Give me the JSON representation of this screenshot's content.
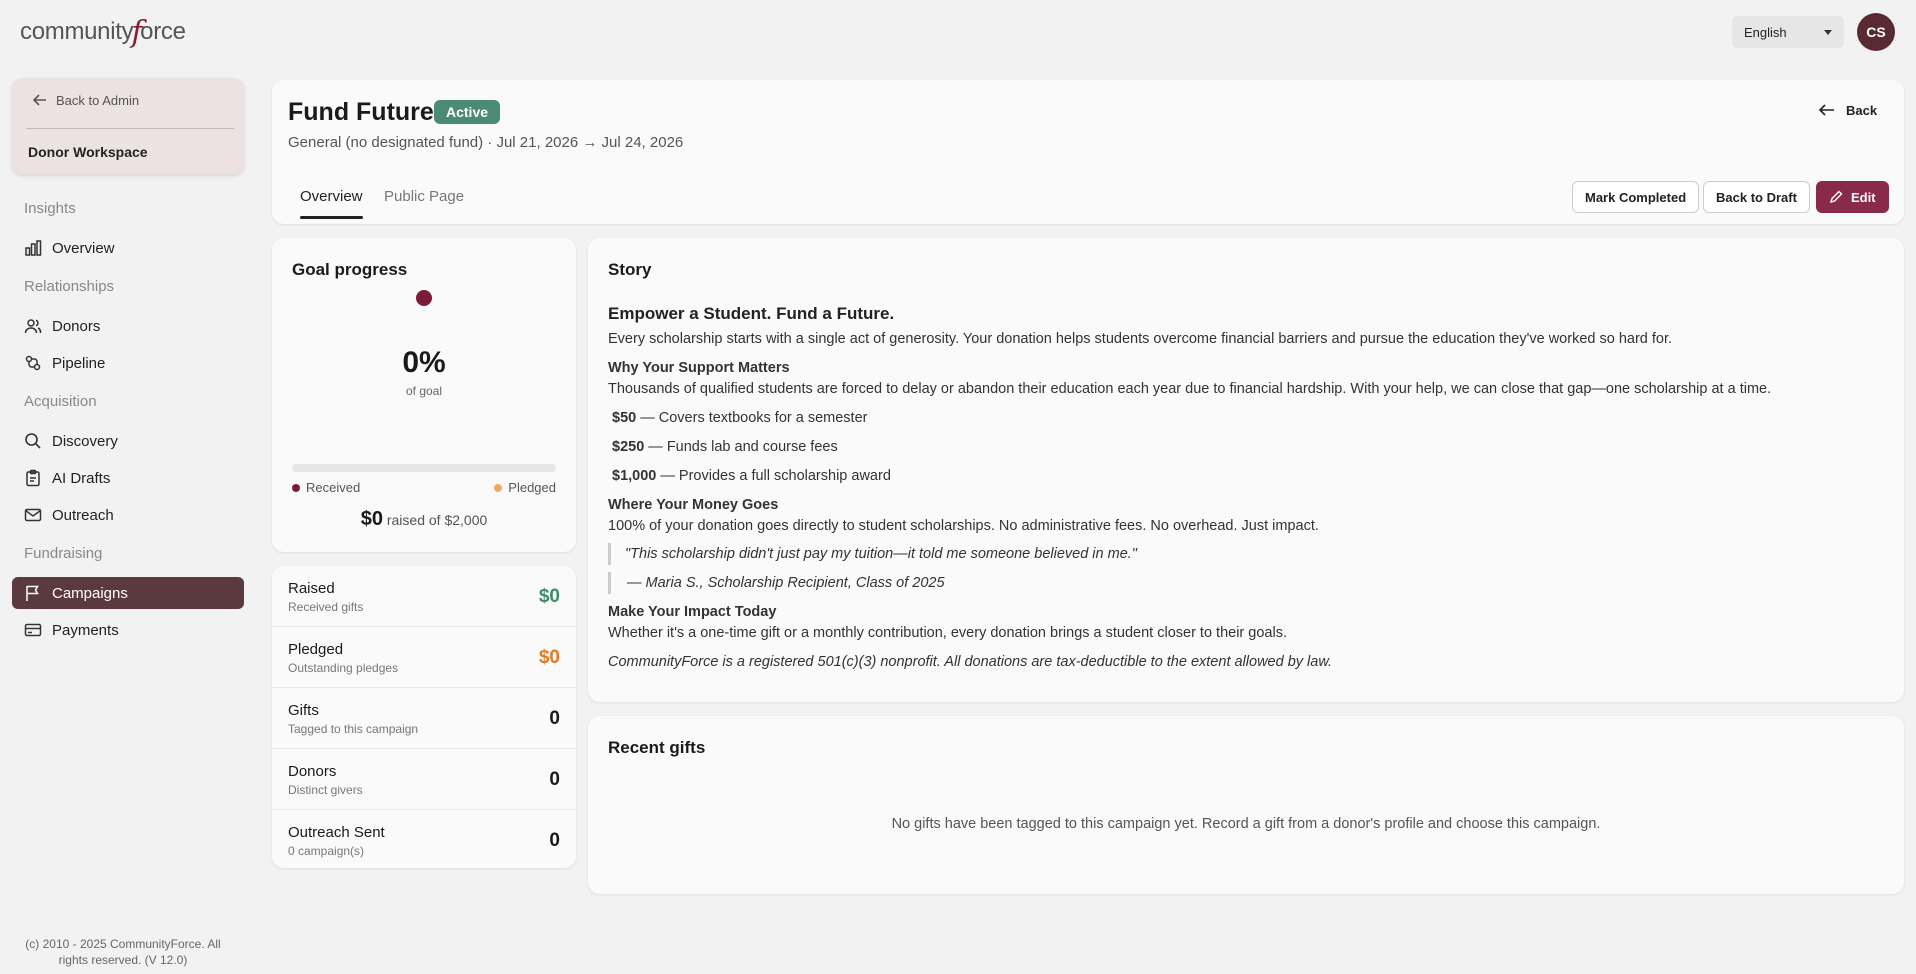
{
  "app": {
    "logo_text_pre": "community",
    "logo_text_f": "f",
    "logo_text_post": "orce",
    "language": "English",
    "avatar_initials": "CS"
  },
  "sidebar": {
    "back_label": "Back to Admin",
    "workspace": "Donor Workspace",
    "sections": {
      "insights": "Insights",
      "relationships": "Relationships",
      "acquisition": "Acquisition",
      "fundraising": "Fundraising"
    },
    "items": {
      "overview": "Overview",
      "donors": "Donors",
      "pipeline": "Pipeline",
      "discovery": "Discovery",
      "ai_drafts": "AI Drafts",
      "outreach": "Outreach",
      "campaigns": "Campaigns",
      "payments": "Payments"
    },
    "footer": "(c) 2010 - 2025 CommunityForce. All rights reserved. (V 12.0)"
  },
  "header": {
    "title": "Fund Future",
    "status": "Active",
    "subtitle": "General (no designated fund) · Jul 21, 2026 → Jul 24, 2026",
    "back": "Back",
    "tabs": {
      "overview": "Overview",
      "public_page": "Public Page"
    },
    "actions": {
      "mark_completed": "Mark Completed",
      "back_to_draft": "Back to Draft",
      "edit": "Edit"
    }
  },
  "goal": {
    "title": "Goal progress",
    "percent": "0%",
    "percent_sub": "of goal",
    "progress_fraction": 0,
    "legend_received": "Received",
    "legend_pledged": "Pledged",
    "raised_amount": "$0",
    "raised_text": "raised of $2,000",
    "colors": {
      "received": "#7a1e38",
      "pledged": "#f0a860"
    }
  },
  "stats": [
    {
      "label": "Raised",
      "sub": "Received gifts",
      "value": "$0",
      "color": "#3f8a6c"
    },
    {
      "label": "Pledged",
      "sub": "Outstanding pledges",
      "value": "$0",
      "color": "#e07a1f"
    },
    {
      "label": "Gifts",
      "sub": "Tagged to this campaign",
      "value": "0",
      "color": "#1a1a1a"
    },
    {
      "label": "Donors",
      "sub": "Distinct givers",
      "value": "0",
      "color": "#1a1a1a"
    },
    {
      "label": "Outreach Sent",
      "sub": "0 campaign(s)",
      "value": "0",
      "color": "#1a1a1a"
    }
  ],
  "story": {
    "title": "Story",
    "headline": "Empower a Student. Fund a Future.",
    "intro": "Every scholarship starts with a single act of generosity. Your donation helps students overcome financial barriers and pursue the education they've worked so hard for.",
    "why_heading": "Why Your Support Matters",
    "why_text": "Thousands of qualified students are forced to delay or abandon their education each year due to financial hardship. With your help, we can close that gap—one scholarship at a time.",
    "tiers": [
      {
        "amount": "$50",
        "text": " — Covers textbooks for a semester"
      },
      {
        "amount": "$250",
        "text": " — Funds lab and course fees"
      },
      {
        "amount": "$1,000",
        "text": " — Provides a full scholarship award"
      }
    ],
    "money_heading": "Where Your Money Goes",
    "money_text": "100% of your donation goes directly to student scholarships. No administrative fees. No overhead. Just impact.",
    "quote": "\"This scholarship didn't just pay my tuition—it told me someone believed in me.\"",
    "attribution": "— Maria S., Scholarship Recipient, Class of 2025",
    "impact_heading": "Make Your Impact Today",
    "impact_text": "Whether it's a one-time gift or a monthly contribution, every donation brings a student closer to their goals.",
    "disclaimer": "CommunityForce is a registered 501(c)(3) nonprofit. All donations are tax-deductible to the extent allowed by law."
  },
  "recent_gifts": {
    "title": "Recent gifts",
    "empty": "No gifts have been tagged to this campaign yet. Record a gift from a donor's profile and choose this campaign."
  }
}
